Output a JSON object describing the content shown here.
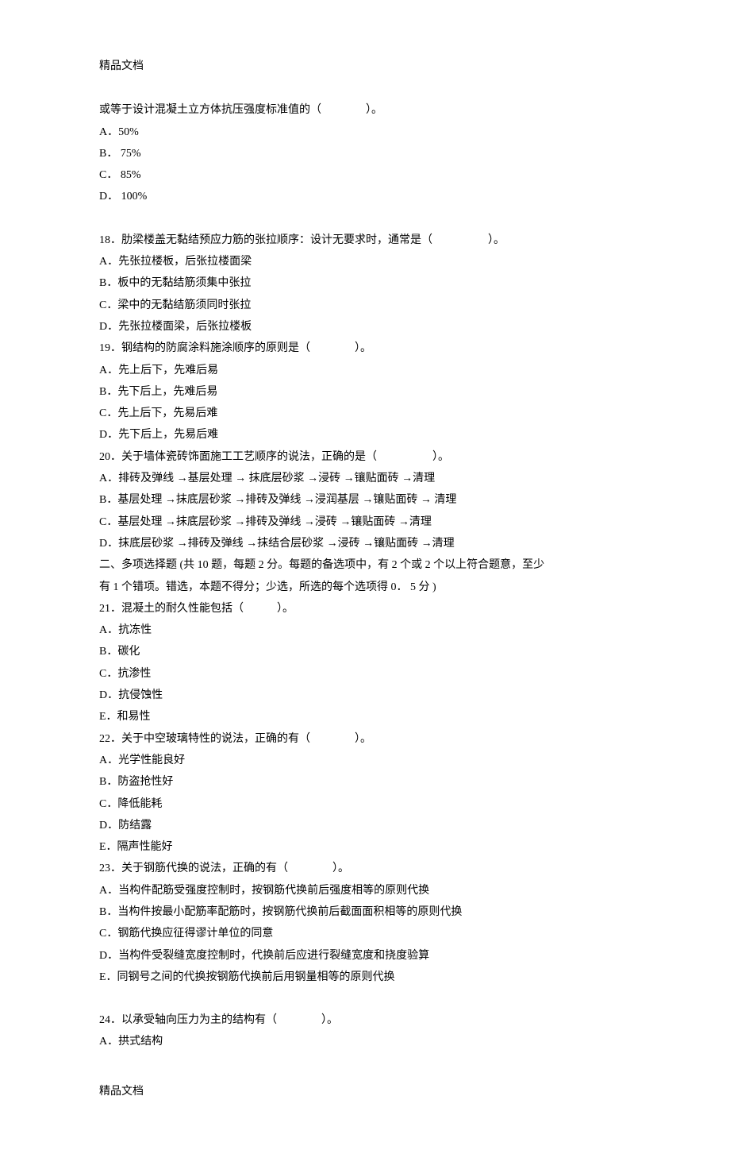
{
  "header": "精品文档",
  "footer": "精品文档",
  "q17_stem": "或等于设计混凝土立方体抗压强度标准值的（　　　　）。",
  "q17_a": "A．50%",
  "q17_b": "B． 75%",
  "q17_c": "C． 85%",
  "q17_d": "D． 100%",
  "q18_stem": "18．肋梁楼盖无黏结预应力筋的张拉顺序：设计无要求时，通常是（　　　　　）。",
  "q18_a": "A．先张拉楼板，后张拉楼面梁",
  "q18_b": "B．板中的无黏结筋须集中张拉",
  "q18_c": "C．梁中的无黏结筋须同时张拉",
  "q18_d": "D．先张拉楼面梁，后张拉楼板",
  "q19_stem": "19．钢结构的防腐涂料施涂顺序的原则是（　　　　）。",
  "q19_a": "A．先上后下，先难后易",
  "q19_b": "B．先下后上，先难后易",
  "q19_c": "C．先上后下，先易后难",
  "q19_d": "D．先下后上，先易后难",
  "q20_stem": "20．关于墙体瓷砖饰面施工工艺顺序的说法，正确的是（　　　　　）。",
  "q20_a": "A．排砖及弹线   →基层处理   → 抹底层砂浆  →浸砖  →镶贴面砖  →清理",
  "q20_b": "B．基层处理   →抹底层砂浆   →排砖及弹线   →浸润基层  →镶贴面砖  → 清理",
  "q20_c": "C．基层处理   →抹底层砂浆   →排砖及弹线   →浸砖  →镶贴面砖  →清理",
  "q20_d": "D．抹底层砂浆   →排砖及弹线   →抹结合层砂浆  →浸砖  →镶贴面砖  →清理",
  "section2_1": "二、多项选择题  (共 10 题，每题 2 分。每题的备选项中，有     2 个或 2 个以上符合题意，至少",
  "section2_2": "有 1 个错项。错选，本题不得分；少选，所选的每个选项得        0． 5 分 )",
  "q21_stem": "21．混凝土的耐久性能包括（　　　）。",
  "q21_a": "A．抗冻性",
  "q21_b": "B．碳化",
  "q21_c": "C．抗渗性",
  "q21_d": "D．抗侵蚀性",
  "q21_e": "E．和易性",
  "q22_stem": "22．关于中空玻璃特性的说法，正确的有（　　　　）。",
  "q22_a": "A．光学性能良好",
  "q22_b": "B．防盗抢性好",
  "q22_c": "C．降低能耗",
  "q22_d": "D．防结露",
  "q22_e": "E．隔声性能好",
  "q23_stem": "23．关于钢筋代换的说法，正确的有（　　　　）。",
  "q23_a": "A．当构件配筋受强度控制时，按钢筋代换前后强度相等的原则代换",
  "q23_b": "B．当构件按最小配筋率配筋时，按钢筋代换前后截面面积相等的原则代换",
  "q23_c": "C．钢筋代换应征得谬计单位的同意",
  "q23_d": "D．当构件受裂缝宽度控制时，代换前后应进行裂缝宽度和挠度验算",
  "q23_e": "E．同钢号之间的代换按钢筋代换前后用钢量相等的原则代换",
  "q24_stem": "24．以承受轴向压力为主的结构有（　　　　）。",
  "q24_a": "A．拱式结构"
}
